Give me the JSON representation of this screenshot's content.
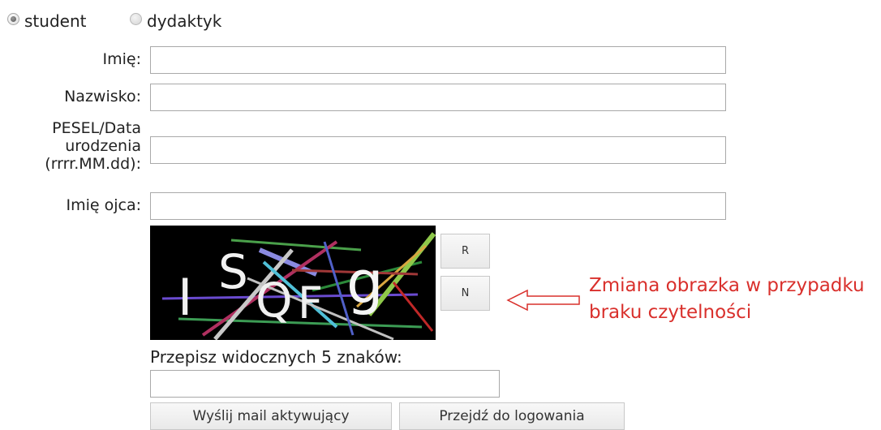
{
  "role_select": {
    "options": [
      {
        "label": "student",
        "selected": true
      },
      {
        "label": "dydaktyk",
        "selected": false
      }
    ]
  },
  "form": {
    "first_name_label": "Imię:",
    "first_name_value": "",
    "last_name_label": "Nazwisko:",
    "last_name_value": "",
    "pesel_label_lines": [
      "PESEL/Data",
      "urodzenia",
      "(rrrr.MM.dd):"
    ],
    "pesel_value": "",
    "father_name_label": "Imię ojca:",
    "father_name_value": ""
  },
  "captcha": {
    "characters": [
      "I",
      "S",
      "Q",
      "F",
      "g"
    ],
    "refresh_label": "R",
    "new_label": "N",
    "prompt": "Przepisz widocznych 5 znaków:",
    "input_value": ""
  },
  "annotation": {
    "lines": [
      "Zmiana obrazka w przypadku",
      "braku czytelności"
    ],
    "color": "#d9302c"
  },
  "actions": {
    "send_activation_label": "Wyślij mail aktywujący",
    "go_to_login_label": "Przejdź do logowania"
  }
}
